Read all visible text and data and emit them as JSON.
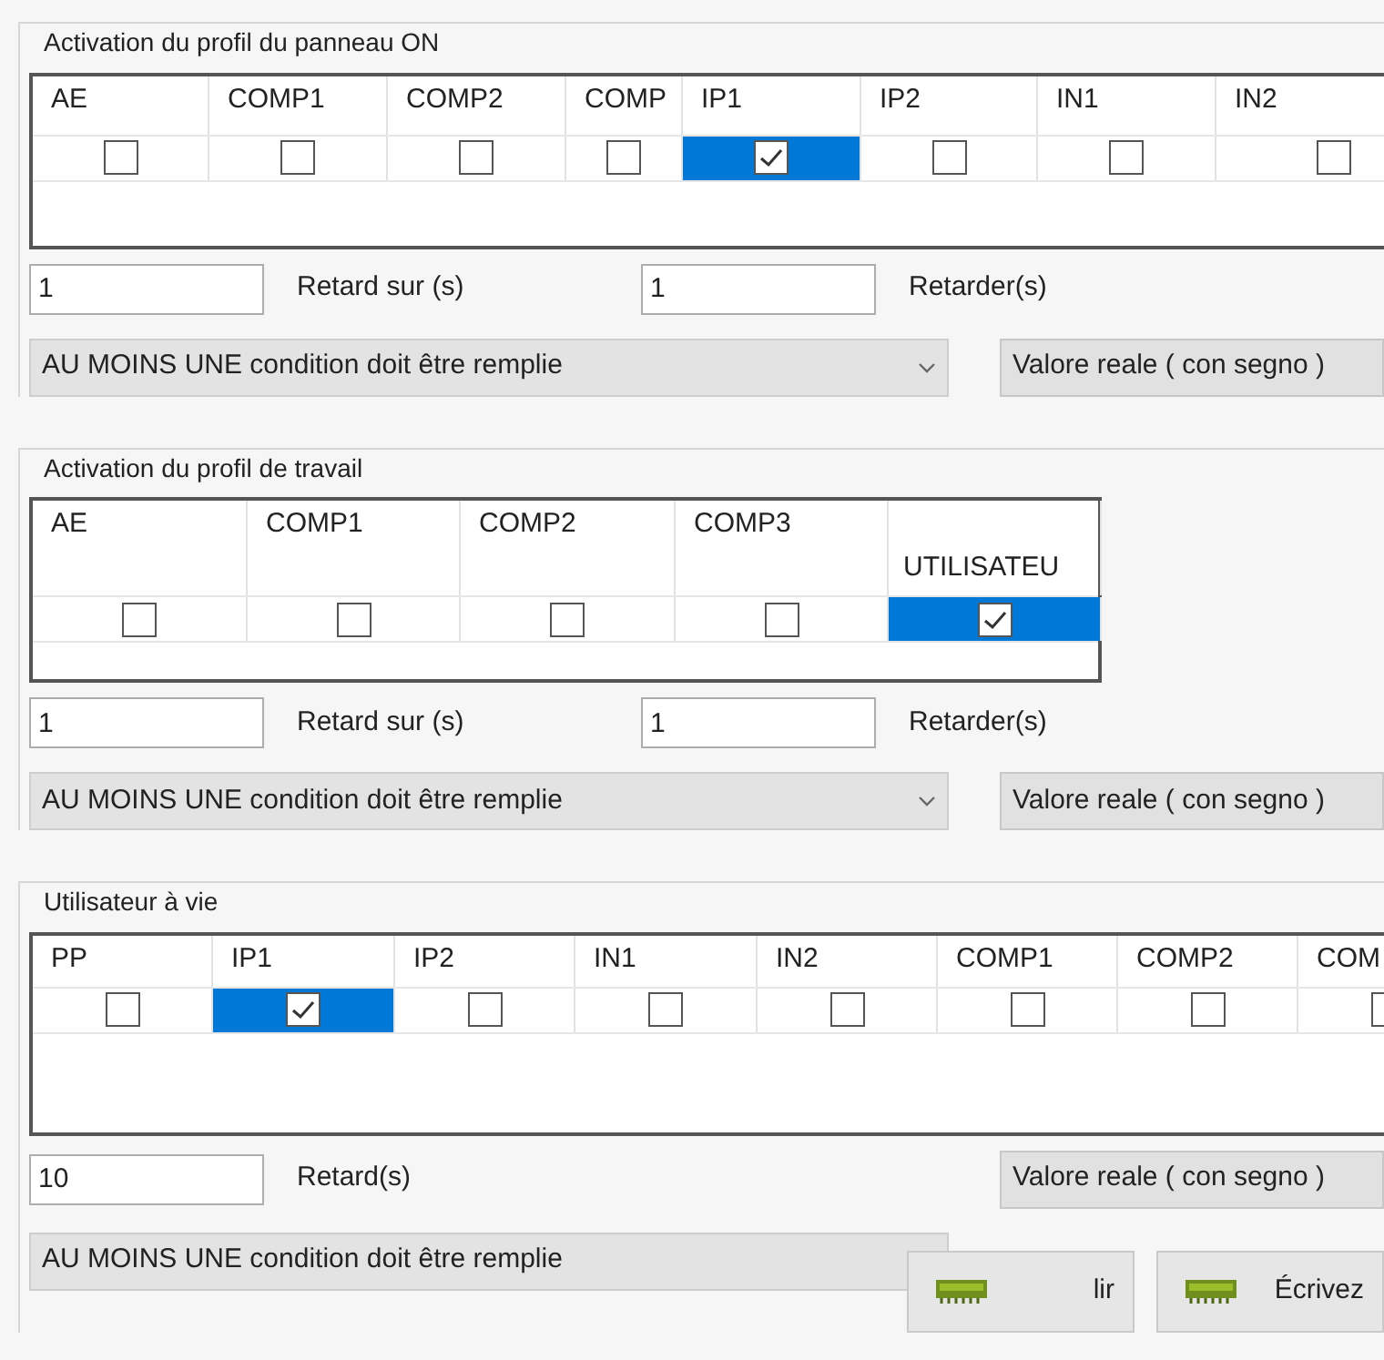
{
  "sections": [
    {
      "title": "Activation du profil du panneau ON",
      "kind": "standard",
      "columns": [
        {
          "label": "AE",
          "checked": false,
          "selected": false
        },
        {
          "label": "COMP1",
          "checked": false,
          "selected": false
        },
        {
          "label": "COMP2",
          "checked": false,
          "selected": false
        },
        {
          "label": "COMP",
          "checked": false,
          "selected": false
        },
        {
          "label": "IP1",
          "checked": true,
          "selected": true
        },
        {
          "label": "IP2",
          "checked": false,
          "selected": false
        },
        {
          "label": "IN1",
          "checked": false,
          "selected": false
        },
        {
          "label": "IN2",
          "checked": false,
          "selected": false
        }
      ],
      "delay_row": [
        {
          "kind": "input",
          "text": "1"
        },
        {
          "kind": "label",
          "text": "Retard sur (s)"
        },
        {
          "kind": "input",
          "text": "1"
        },
        {
          "kind": "label",
          "text": "Retarder(s)"
        }
      ],
      "condition": {
        "kind": "dropdown",
        "value": "AU MOINS UNE condition doit être remplie"
      },
      "value_type": "Valore reale ( con segno )"
    },
    {
      "title": "Activation du profil de travail",
      "kind": "standard",
      "columns": [
        {
          "label": "AE",
          "checked": false,
          "selected": false
        },
        {
          "label": "COMP1",
          "checked": false,
          "selected": false
        },
        {
          "label": "COMP2",
          "checked": false,
          "selected": false
        },
        {
          "label": "COMP3",
          "checked": false,
          "selected": false
        },
        {
          "label": "UTILISATEU",
          "checked": true,
          "selected": true
        }
      ],
      "delay_row": [
        {
          "kind": "input",
          "text": "1"
        },
        {
          "kind": "label",
          "text": "Retard sur (s)"
        },
        {
          "kind": "input",
          "text": "1"
        },
        {
          "kind": "label",
          "text": "Retarder(s)"
        }
      ],
      "condition": {
        "kind": "dropdown",
        "value": "AU MOINS UNE condition doit être remplie"
      },
      "value_type": "Valore reale ( con segno )"
    },
    {
      "title": "Utilisateur à vie",
      "kind": "compact",
      "columns": [
        {
          "label": "PP",
          "checked": false,
          "selected": false
        },
        {
          "label": "IP1",
          "checked": true,
          "selected": true
        },
        {
          "label": "IP2",
          "checked": false,
          "selected": false
        },
        {
          "label": "IN1",
          "checked": false,
          "selected": false
        },
        {
          "label": "IN2",
          "checked": false,
          "selected": false
        },
        {
          "label": "COMP1",
          "checked": false,
          "selected": false
        },
        {
          "label": "COMP2",
          "checked": false,
          "selected": false
        },
        {
          "label": "COM",
          "checked": false,
          "selected": false
        }
      ],
      "delay_row": [
        {
          "kind": "input",
          "text": "10"
        },
        {
          "kind": "label",
          "text": "Retard(s)"
        }
      ],
      "condition": {
        "kind": "box",
        "value": "AU MOINS UNE condition doit être remplie"
      },
      "value_type": "Valore reale ( con segno )"
    }
  ],
  "buttons": [
    {
      "label": "lir"
    },
    {
      "label": "Écrivez"
    }
  ]
}
